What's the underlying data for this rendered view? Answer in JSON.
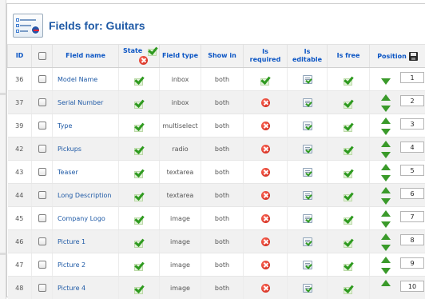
{
  "header": {
    "title": "Fields for: Guitars"
  },
  "columns": {
    "id": "ID",
    "field_name": "Field name",
    "state": "State",
    "field_type": "Field type",
    "show_in": "Show in",
    "is_required_1": "Is",
    "is_required_2": "required",
    "is_editable_1": "Is",
    "is_editable_2": "editable",
    "is_free": "Is free",
    "position": "Position"
  },
  "rows": [
    {
      "id": "36",
      "name": "Model Name",
      "state": "tick",
      "type": "inbox",
      "show_in": "both",
      "required": "tick",
      "editable": "edit",
      "free": "tick",
      "position": "1"
    },
    {
      "id": "37",
      "name": "Serial Number",
      "state": "tick",
      "type": "inbox",
      "show_in": "both",
      "required": "x",
      "editable": "edit",
      "free": "tick",
      "position": "2"
    },
    {
      "id": "39",
      "name": "Type",
      "state": "tick",
      "type": "multiselect",
      "show_in": "both",
      "required": "x",
      "editable": "edit",
      "free": "tick",
      "position": "3"
    },
    {
      "id": "42",
      "name": "Pickups",
      "state": "tick",
      "type": "radio",
      "show_in": "both",
      "required": "x",
      "editable": "edit",
      "free": "tick",
      "position": "4"
    },
    {
      "id": "43",
      "name": "Teaser",
      "state": "tick",
      "type": "textarea",
      "show_in": "both",
      "required": "x",
      "editable": "edit",
      "free": "tick",
      "position": "5"
    },
    {
      "id": "44",
      "name": "Long Description",
      "state": "tick",
      "type": "textarea",
      "show_in": "both",
      "required": "x",
      "editable": "edit",
      "free": "tick",
      "position": "6"
    },
    {
      "id": "45",
      "name": "Company Logo",
      "state": "tick",
      "type": "image",
      "show_in": "both",
      "required": "x",
      "editable": "edit",
      "free": "tick",
      "position": "7"
    },
    {
      "id": "46",
      "name": "Picture 1",
      "state": "tick",
      "type": "image",
      "show_in": "both",
      "required": "x",
      "editable": "edit",
      "free": "tick",
      "position": "8"
    },
    {
      "id": "47",
      "name": "Picture 2",
      "state": "tick",
      "type": "image",
      "show_in": "both",
      "required": "x",
      "editable": "edit",
      "free": "tick",
      "position": "9"
    },
    {
      "id": "48",
      "name": "Picture 4",
      "state": "tick",
      "type": "image",
      "show_in": "both",
      "required": "x",
      "editable": "edit",
      "free": "tick",
      "position": "10"
    }
  ],
  "colors": {
    "title": "#1f5aa6",
    "header_text": "#0b55c4",
    "ok_green": "#2f9a20",
    "error_red": "#c61d10",
    "alt_row": "#f1f1f1"
  },
  "icons": {
    "header": "fields-manager-icon",
    "state_on": "published-tick-icon",
    "state_off": "unpublished-x-icon",
    "required_yes": "tick-icon",
    "required_no": "x-circle-icon",
    "editable": "edit-document-icon",
    "move_up": "arrow-up-icon",
    "move_down": "arrow-down-icon",
    "save_order": "save-order-icon"
  }
}
